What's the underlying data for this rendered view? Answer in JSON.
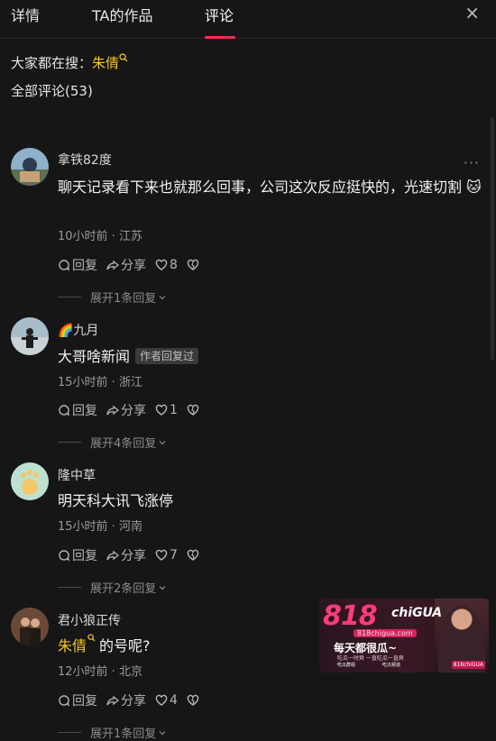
{
  "tabs": [
    {
      "label": "详情"
    },
    {
      "label": "TA的作品"
    },
    {
      "label": "评论"
    }
  ],
  "close_icon": "×",
  "search_hint": {
    "prefix": "大家都在搜：",
    "keyword": "朱倩"
  },
  "comment_count_label": "全部评论(53)",
  "comments": [
    {
      "name": "拿铁82度",
      "text": "聊天记录看下来也就那么回事，公司这次反应挺快的，光速切割 🐱",
      "time_location": "10小时前 · 江苏",
      "reply_label": "回复",
      "share_label": "分享",
      "likes": "8",
      "expand_label": "展开1条回复"
    },
    {
      "name": "🌈九月",
      "text": "大哥啥新闻",
      "badge": "作者回复过",
      "time_location": "15小时前 · 浙江",
      "reply_label": "回复",
      "share_label": "分享",
      "likes": "1",
      "expand_label": "展开4条回复"
    },
    {
      "name": "隆中草",
      "text": "明天科大讯飞涨停",
      "time_location": "15小时前 · 河南",
      "reply_label": "回复",
      "share_label": "分享",
      "likes": "7",
      "expand_label": "展开2条回复"
    },
    {
      "name": "君小狼正传",
      "keyword": "朱倩",
      "text": "的号呢?",
      "time_location": "12小时前 · 北京",
      "reply_label": "回复",
      "share_label": "分享",
      "likes": "4",
      "expand_label": "展开1条回复"
    }
  ],
  "watermark": {
    "logo": "818",
    "logo_suffix": "chiGUA",
    "url": "818chigua.com",
    "slogan": "每天都很瓜~",
    "sub": "吃瓜一时爽 一直吃瓜一直爽",
    "btn1": "吃瓜群组",
    "btn2": "吃瓜频道",
    "brand": "818chiGUA"
  },
  "colors": {
    "accent": "#ff2b55",
    "keyword": "#f5c623",
    "background": "#161616"
  }
}
